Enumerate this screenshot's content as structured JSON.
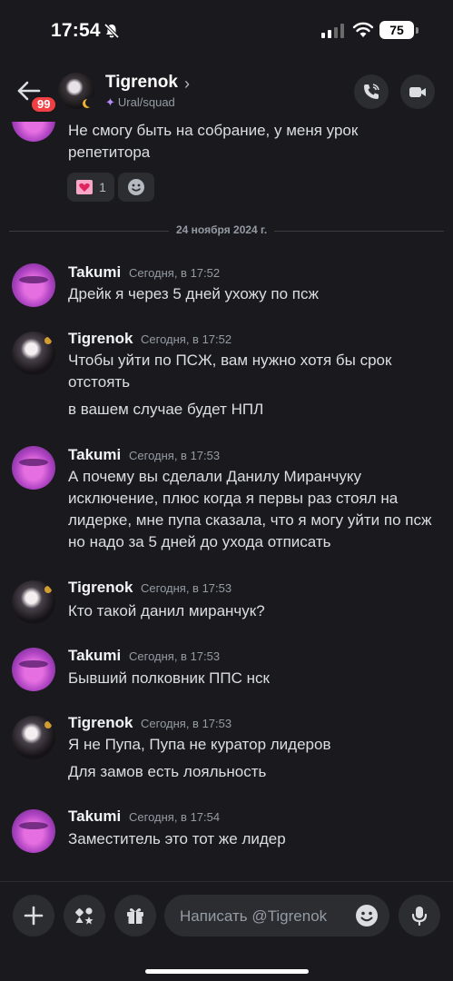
{
  "status_bar": {
    "time": "17:54",
    "battery": "75"
  },
  "header": {
    "unread_count": "99",
    "name": "Tigrenok",
    "status_text": "Ural/squad"
  },
  "date_divider": "24 ноября 2024 г.",
  "messages": [
    {
      "text": "Не смогу быть на собрание, у меня урок",
      "text2": "репетитора",
      "reaction_count": "1"
    },
    {
      "author": "Takumi",
      "timestamp": "Сегодня, в 17:52",
      "lines": [
        "Дрейк я через 5 дней ухожу по псж"
      ]
    },
    {
      "author": "Tigrenok",
      "timestamp": "Сегодня, в 17:52",
      "lines": [
        "Чтобы уйти по ПСЖ, вам нужно хотя бы срок",
        "отстоять",
        "в вашем случае будет НПЛ"
      ]
    },
    {
      "author": "Takumi",
      "timestamp": "Сегодня, в 17:53",
      "lines": [
        "А почему вы сделали Данилу Миранчуку",
        "исключение, плюс когда я первы раз стоял на",
        "лидерке, мне пупа сказала, что я могу уйти по псж",
        "но надо за 5 дней до ухода отписать"
      ]
    },
    {
      "author": "Tigrenok",
      "timestamp": "Сегодня, в 17:53",
      "lines": [
        "Кто такой данил миранчук?"
      ]
    },
    {
      "author": "Takumi",
      "timestamp": "Сегодня, в 17:53",
      "lines": [
        "Бывший полковник ППС нск"
      ]
    },
    {
      "author": "Tigrenok",
      "timestamp": "Сегодня, в 17:53",
      "lines": [
        "Я не Пупа, Пупа не куратор лидеров",
        "Для замов есть лояльность"
      ]
    },
    {
      "author": "Takumi",
      "timestamp": "Сегодня, в 17:54",
      "lines": [
        "Заместитель это тот же лидер"
      ]
    }
  ],
  "composer": {
    "placeholder": "Написать @Tigrenok"
  },
  "colors": {
    "background": "#1a1a1e",
    "surface": "#2b2d31",
    "badge": "#f23f43",
    "muted_text": "#949ba4"
  }
}
